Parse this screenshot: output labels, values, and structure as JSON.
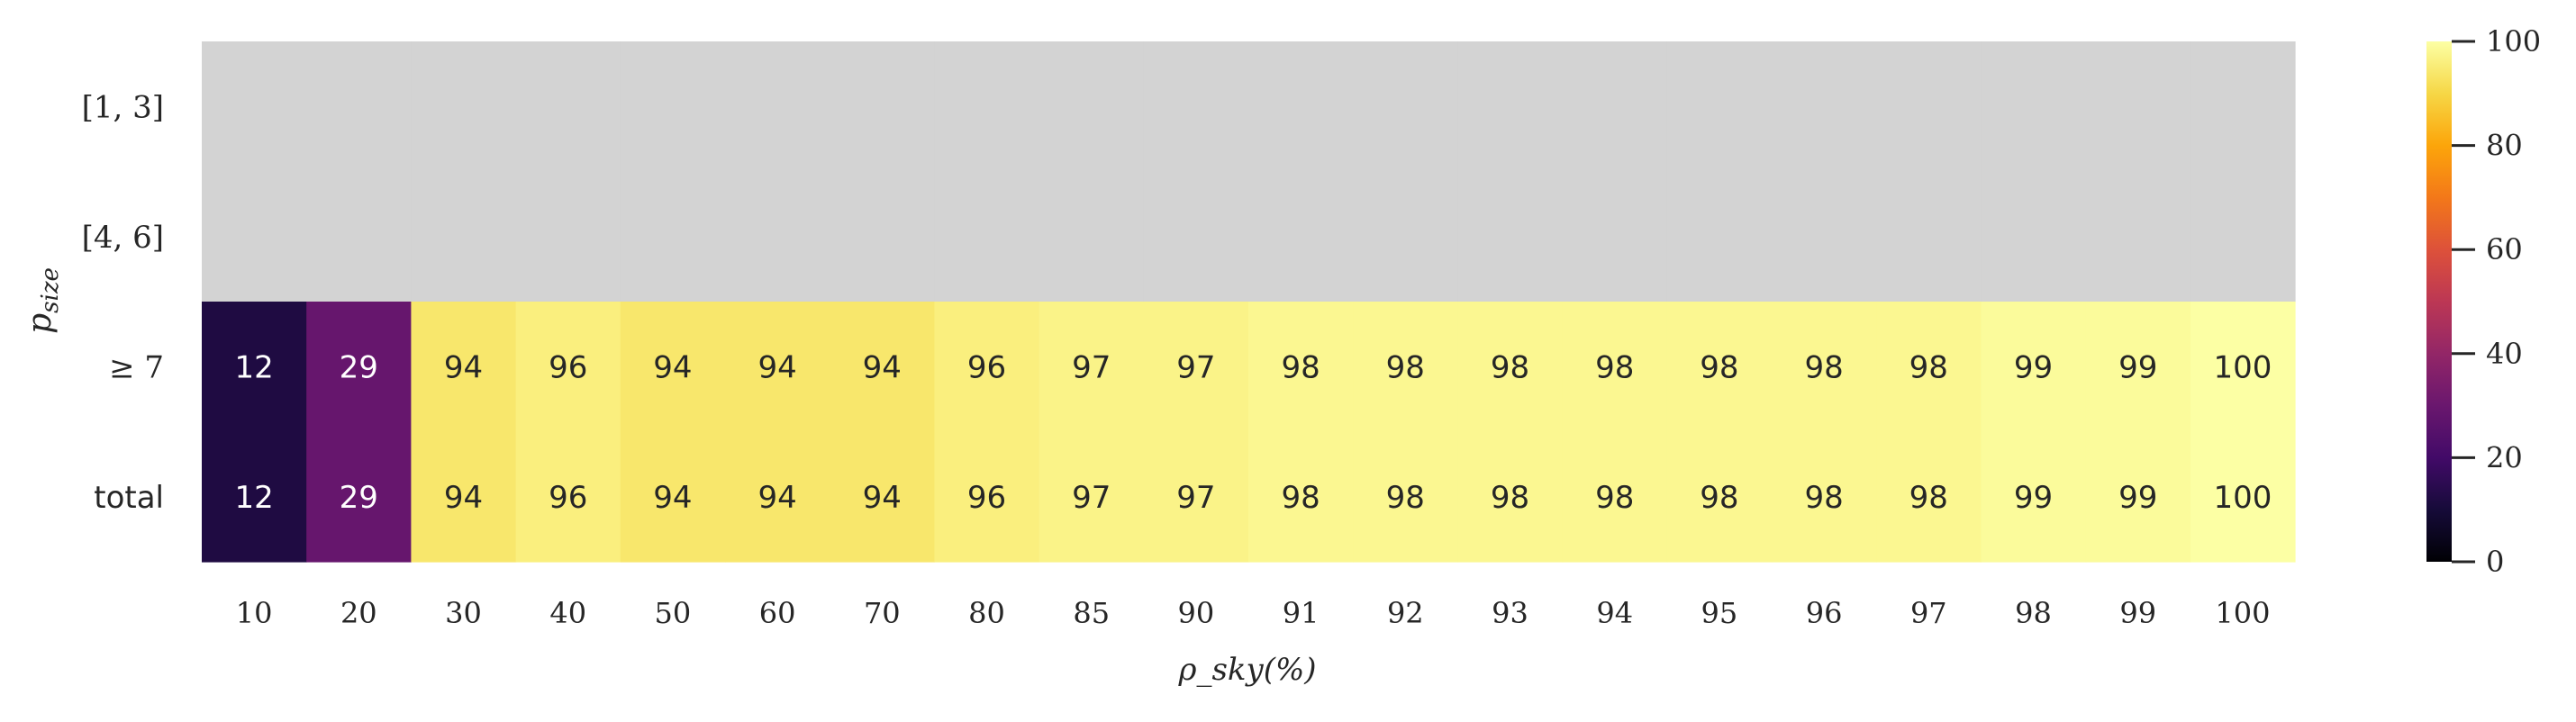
{
  "chart_data": {
    "type": "heatmap",
    "xlabel": "ρ_sky(%)",
    "ylabel": "p_size",
    "x_categories": [
      "10",
      "20",
      "30",
      "40",
      "50",
      "60",
      "70",
      "80",
      "85",
      "90",
      "91",
      "92",
      "93",
      "94",
      "95",
      "96",
      "97",
      "98",
      "99",
      "100"
    ],
    "y_categories": [
      "[1, 3]",
      "[4, 6]",
      "≥ 7",
      "total"
    ],
    "values": [
      [
        null,
        null,
        null,
        null,
        null,
        null,
        null,
        null,
        null,
        null,
        null,
        null,
        null,
        null,
        null,
        null,
        null,
        null,
        null,
        null
      ],
      [
        null,
        null,
        null,
        null,
        null,
        null,
        null,
        null,
        null,
        null,
        null,
        null,
        null,
        null,
        null,
        null,
        null,
        null,
        null,
        null
      ],
      [
        12,
        29,
        94,
        96,
        94,
        94,
        94,
        96,
        97,
        97,
        98,
        98,
        98,
        98,
        98,
        98,
        98,
        99,
        99,
        100
      ],
      [
        12,
        29,
        94,
        96,
        94,
        94,
        94,
        96,
        97,
        97,
        98,
        98,
        98,
        98,
        98,
        98,
        98,
        99,
        99,
        100
      ]
    ],
    "missing_color": "#d3d3d3",
    "colormap": "inferno",
    "colorbar": {
      "range": [
        0,
        100
      ],
      "ticks": [
        "0",
        "20",
        "40",
        "60",
        "80",
        "100"
      ]
    },
    "annotations": true,
    "grid": false
  }
}
